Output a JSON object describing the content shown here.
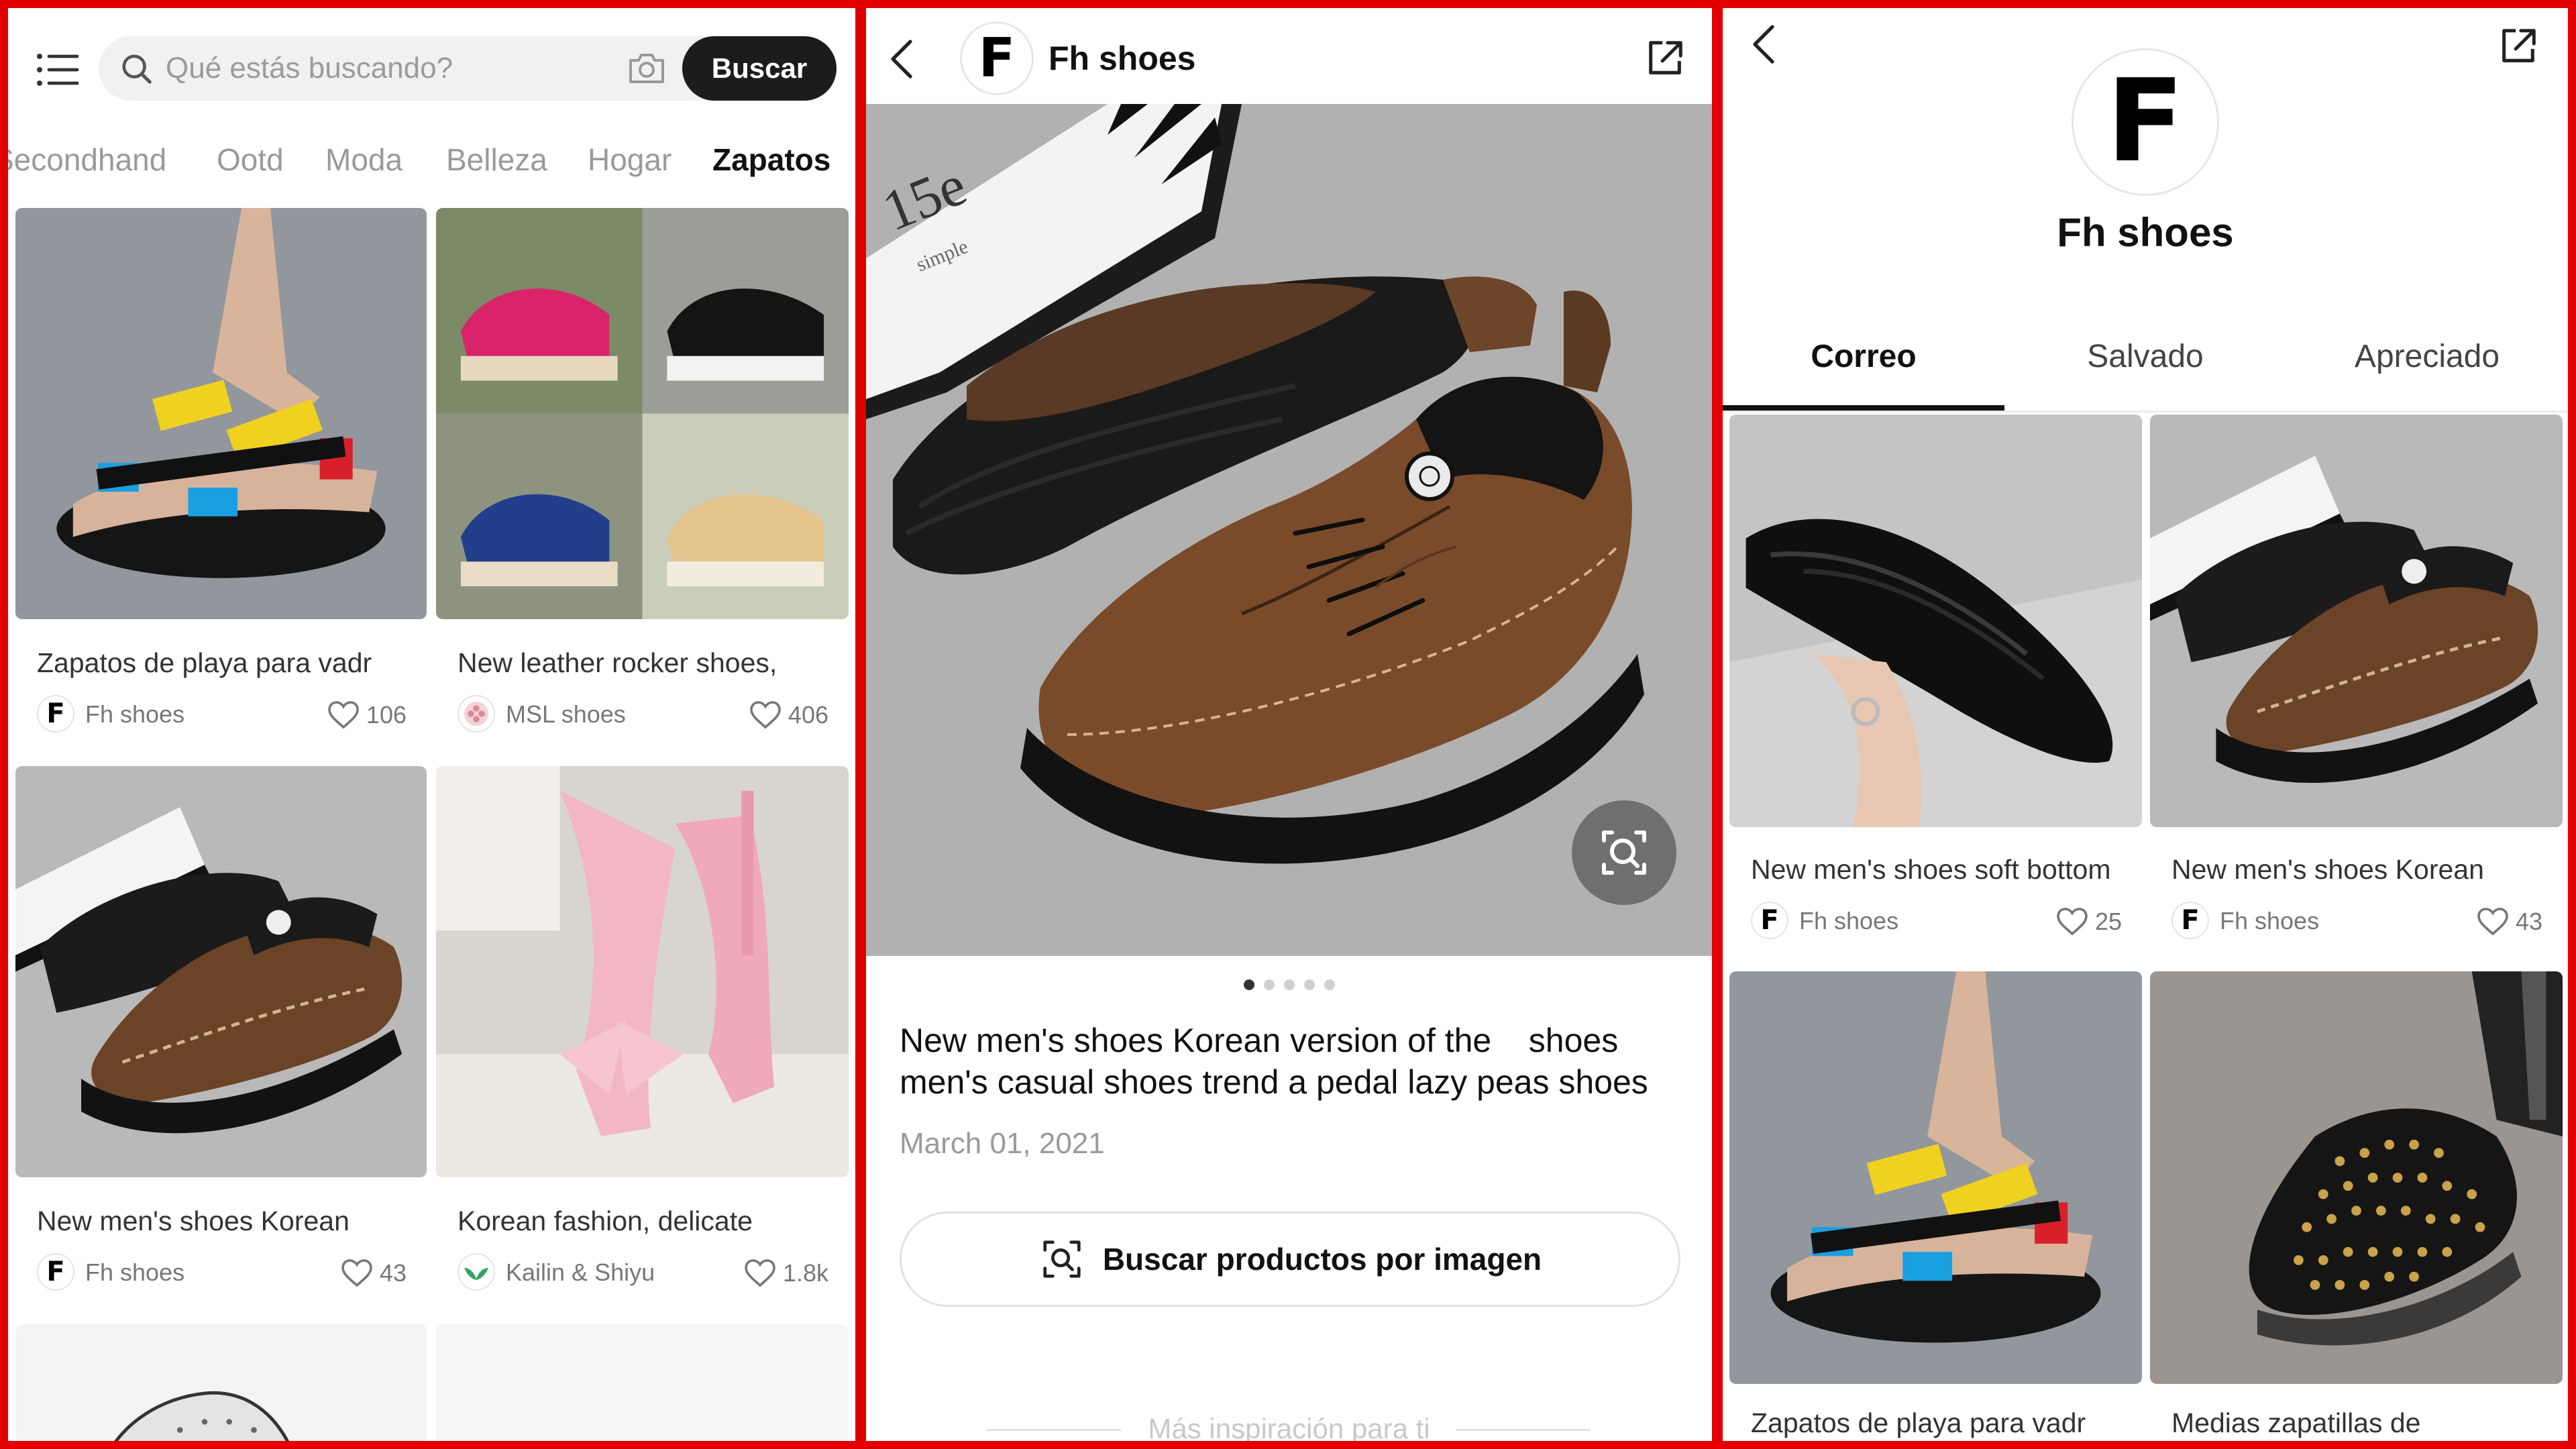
{
  "panel1": {
    "search": {
      "placeholder": "Qué estás buscando?",
      "button": "Buscar"
    },
    "categories": [
      {
        "label": "Secondhand"
      },
      {
        "label": "Ootd"
      },
      {
        "label": "Moda"
      },
      {
        "label": "Belleza"
      },
      {
        "label": "Hogar"
      },
      {
        "label": "Zapatos",
        "active": true
      }
    ],
    "cards": [
      {
        "title": "Zapatos de playa para vadr",
        "author": "Fh shoes",
        "avatar": "F",
        "likes": "106"
      },
      {
        "title": "New leather rocker shoes,",
        "author": "MSL shoes",
        "avatar": "",
        "likes": "406"
      },
      {
        "title": "New men's shoes Korean",
        "author": "Fh shoes",
        "avatar": "F",
        "likes": "43"
      },
      {
        "title": "Korean fashion, delicate",
        "author": "Kailin & Shiyu",
        "avatar": "",
        "likes": "1.8k"
      }
    ]
  },
  "panel2": {
    "header": {
      "avatar": "F",
      "name": "Fh shoes"
    },
    "hero": {
      "box_text": "15e",
      "box_subtext": "simple"
    },
    "carousel": {
      "total": 5,
      "current": 1
    },
    "title": "New men's shoes Korean version of the    shoes men's casual shoes trend a pedal lazy peas shoes",
    "date": "March 01, 2021",
    "image_search_button": "Buscar productos por imagen",
    "more_inspiration": "Más inspiración para ti"
  },
  "panel3": {
    "profile": {
      "avatar": "F",
      "name": "Fh shoes"
    },
    "tabs": [
      {
        "label": "Correo",
        "active": true
      },
      {
        "label": "Salvado"
      },
      {
        "label": "Apreciado"
      }
    ],
    "cards": [
      {
        "title": "New men's shoes soft bottom",
        "author": "Fh shoes",
        "avatar": "F",
        "likes": "25"
      },
      {
        "title": "New men's shoes Korean",
        "author": "Fh shoes",
        "avatar": "F",
        "likes": "43"
      },
      {
        "title": "Zapatos de playa para vadr"
      },
      {
        "title": "Medias zapatillas de"
      }
    ]
  },
  "colors": {
    "frame": "#e00000",
    "text": "#111111",
    "muted": "#9a9a9a",
    "button": "#1c1c1c"
  },
  "icons": [
    "menu-icon",
    "search-icon",
    "camera-icon",
    "heart-icon",
    "back-icon",
    "share-icon",
    "image-search-icon"
  ]
}
